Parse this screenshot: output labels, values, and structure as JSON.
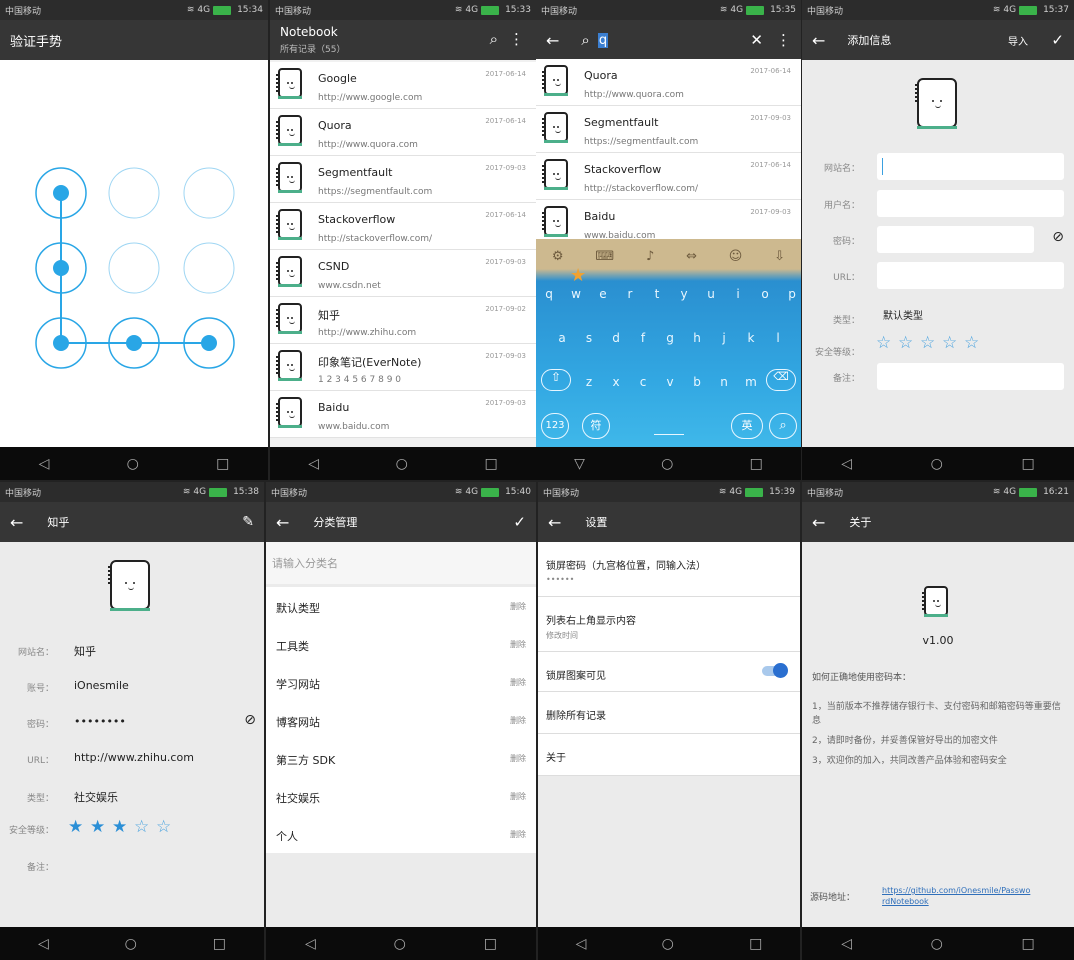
{
  "status": {
    "carrier": "中国移动",
    "signal": "4G",
    "times": [
      "15:34",
      "15:33",
      "15:35",
      "15:37",
      "15:38",
      "15:40",
      "15:39",
      "16:21"
    ]
  },
  "s1": {
    "title": "验证手势"
  },
  "s2": {
    "title": "Notebook",
    "subtitle": "所有记录（55）",
    "items": [
      {
        "name": "Google",
        "url": "http://www.google.com",
        "date": "2017-06-14"
      },
      {
        "name": "Quora",
        "url": "http://www.quora.com",
        "date": "2017-06-14"
      },
      {
        "name": "Segmentfault",
        "url": "https://segmentfault.com",
        "date": "2017-09-03"
      },
      {
        "name": "Stackoverflow",
        "url": "http://stackoverflow.com/",
        "date": "2017-06-14"
      },
      {
        "name": "CSND",
        "url": "www.csdn.net",
        "date": "2017-09-03"
      },
      {
        "name": "知乎",
        "url": "http://www.zhihu.com",
        "date": "2017-09-02"
      },
      {
        "name": "印象笔记(EverNote)",
        "url": "1 2 3 4 5 6 7 8 9 0",
        "date": "2017-09-03"
      },
      {
        "name": "Baidu",
        "url": "www.baidu.com",
        "date": "2017-09-03"
      }
    ]
  },
  "s3": {
    "query": "q",
    "items": [
      {
        "name": "Quora",
        "url": "http://www.quora.com",
        "date": "2017-06-14"
      },
      {
        "name": "Segmentfault",
        "url": "https://segmentfault.com",
        "date": "2017-09-03"
      },
      {
        "name": "Stackoverflow",
        "url": "http://stackoverflow.com/",
        "date": "2017-06-14"
      },
      {
        "name": "Baidu",
        "url": "www.baidu.com",
        "date": "2017-09-03"
      }
    ],
    "keys1": [
      "q",
      "w",
      "e",
      "r",
      "t",
      "y",
      "u",
      "i",
      "o",
      "p"
    ],
    "keys2": [
      "a",
      "s",
      "d",
      "f",
      "g",
      "h",
      "j",
      "k",
      "l"
    ],
    "keys3": [
      "z",
      "x",
      "c",
      "v",
      "b",
      "n",
      "m"
    ],
    "k123": "123",
    "kfu": "符",
    "kying": "英"
  },
  "s4": {
    "title": "添加信息",
    "import": "导入",
    "labels": [
      "网站名：",
      "用户名：",
      "密码：",
      "URL：",
      "类型：",
      "安全等级：",
      "备注："
    ],
    "type_value": "默认类型",
    "stars": 0
  },
  "s5": {
    "title": "知乎",
    "labels": [
      "网站名：",
      "账号：",
      "密码：",
      "URL：",
      "类型：",
      "安全等级：",
      "备注："
    ],
    "values": [
      "知乎",
      "iOnesmile",
      "••••••••",
      "http://www.zhihu.com",
      "社交娱乐"
    ],
    "stars": 3
  },
  "s6": {
    "title": "分类管理",
    "placeholder": "请输入分类名",
    "delete": "删除",
    "cats": [
      "默认类型",
      "工具类",
      "学习网站",
      "博客网站",
      "第三方 SDK",
      "社交娱乐",
      "个人"
    ]
  },
  "s7": {
    "title": "设置",
    "items": [
      {
        "t": "锁屏密码（九宫格位置，同输入法）",
        "s": "••••••"
      },
      {
        "t": "列表右上角显示内容",
        "s": "修改时间"
      },
      {
        "t": "锁屏图案可见",
        "s": ""
      },
      {
        "t": "删除所有记录",
        "s": ""
      },
      {
        "t": "关于",
        "s": ""
      }
    ]
  },
  "s8": {
    "title": "关于",
    "version": "v1.00",
    "howto": "如何正确地使用密码本：",
    "tips": [
      "1，当前版本不推荐储存银行卡、支付密码和邮箱密码等重要信息",
      "2，请即时备份，并妥善保管好导出的加密文件",
      "3，欢迎你的加入，共同改善产品体验和密码安全"
    ],
    "src_label": "源码地址：",
    "src_link": "https://github.com/iOnesmile/PasswordNotebook"
  }
}
